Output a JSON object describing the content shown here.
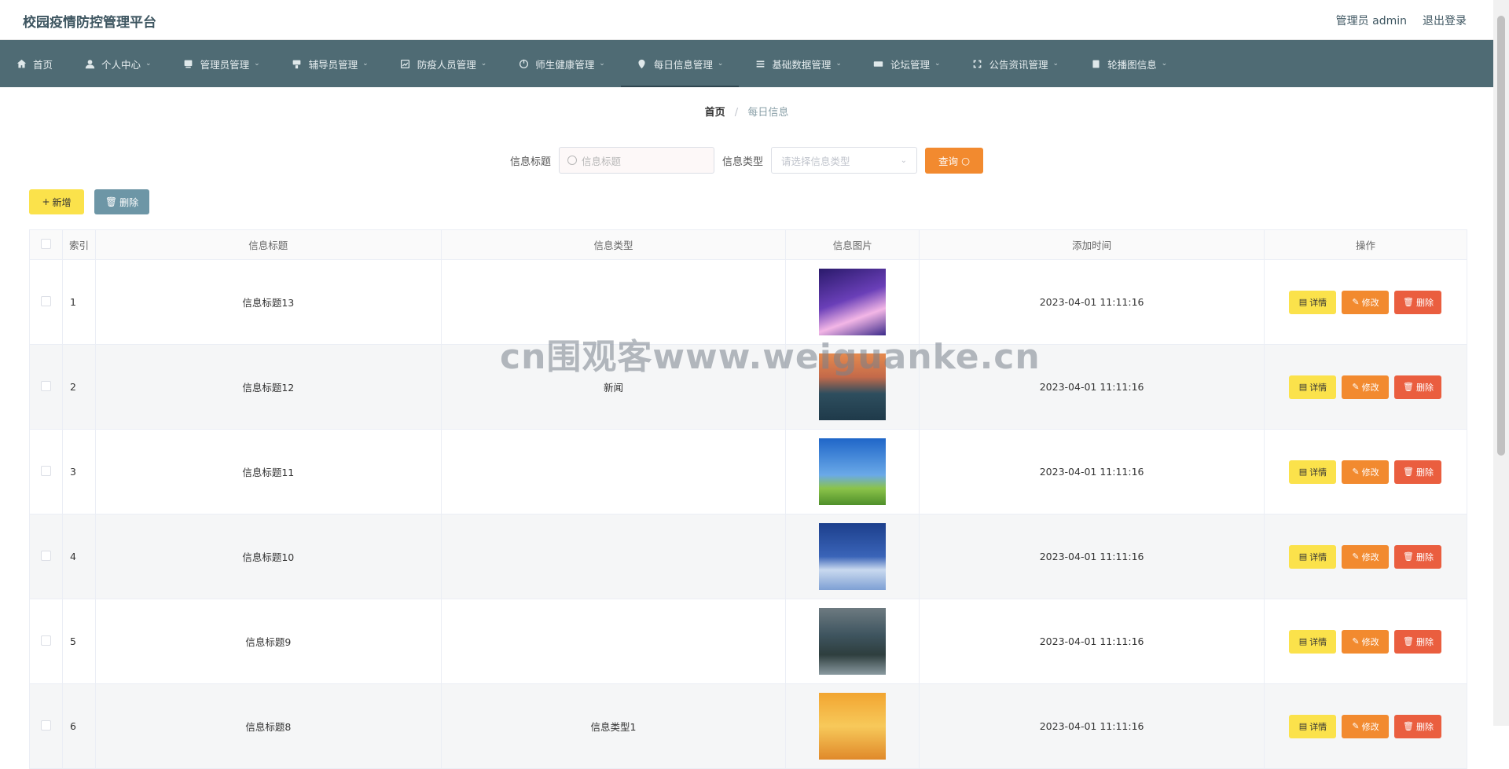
{
  "app": {
    "title": "校园疫情防控管理平台"
  },
  "user": {
    "role_label": "管理员 admin",
    "logout_label": "退出登录"
  },
  "nav": [
    {
      "label": "首页",
      "icon": "home-icon",
      "dropdown": false
    },
    {
      "label": "个人中心",
      "icon": "user-icon",
      "dropdown": true
    },
    {
      "label": "管理员管理",
      "icon": "admin-icon",
      "dropdown": true
    },
    {
      "label": "辅导员管理",
      "icon": "counselor-icon",
      "dropdown": true
    },
    {
      "label": "防疫人员管理",
      "icon": "staff-icon",
      "dropdown": true
    },
    {
      "label": "师生健康管理",
      "icon": "health-icon",
      "dropdown": true
    },
    {
      "label": "每日信息管理",
      "icon": "pin-icon",
      "dropdown": true,
      "active": true
    },
    {
      "label": "基础数据管理",
      "icon": "list-icon",
      "dropdown": true
    },
    {
      "label": "论坛管理",
      "icon": "forum-icon",
      "dropdown": true
    },
    {
      "label": "公告资讯管理",
      "icon": "notice-icon",
      "dropdown": true
    },
    {
      "label": "轮播图信息",
      "icon": "image-icon",
      "dropdown": true
    }
  ],
  "breadcrumb": {
    "home": "首页",
    "current": "每日信息"
  },
  "search": {
    "title_label": "信息标题",
    "title_placeholder": "信息标题",
    "type_label": "信息类型",
    "type_placeholder": "请选择信息类型",
    "query_label": "查询"
  },
  "actions": {
    "add_label": "新增",
    "delete_label": "删除"
  },
  "table": {
    "headers": [
      "",
      "索引",
      "信息标题",
      "信息类型",
      "信息图片",
      "添加时间",
      "操作"
    ],
    "rows": [
      {
        "index": "1",
        "title": "信息标题13",
        "type": "",
        "image": "eiffel-tower-night",
        "time": "2023-04-01 11:11:16"
      },
      {
        "index": "2",
        "title": "信息标题12",
        "type": "新闻",
        "image": "lake-sunset",
        "time": "2023-04-01 11:11:16"
      },
      {
        "index": "3",
        "title": "信息标题11",
        "type": "",
        "image": "green-field-sky",
        "time": "2023-04-01 11:11:16"
      },
      {
        "index": "4",
        "title": "信息标题10",
        "type": "",
        "image": "snow-cabin-night",
        "time": "2023-04-01 11:11:16"
      },
      {
        "index": "5",
        "title": "信息标题9",
        "type": "",
        "image": "mountain-lake-town",
        "time": "2023-04-01 11:11:16"
      },
      {
        "index": "6",
        "title": "信息标题8",
        "type": "信息类型1",
        "image": "sunset-clouds",
        "time": "2023-04-01 11:11:16"
      }
    ],
    "op_labels": {
      "detail": "详情",
      "edit": "修改",
      "remove": "删除"
    }
  },
  "watermark": "cn围观客www.weiguanke.cn",
  "colors": {
    "nav_bg": "#4f6b74",
    "query": "#f28a2f",
    "add": "#fbe24b",
    "delete": "#6d96a6",
    "remove": "#ea5e3f"
  }
}
